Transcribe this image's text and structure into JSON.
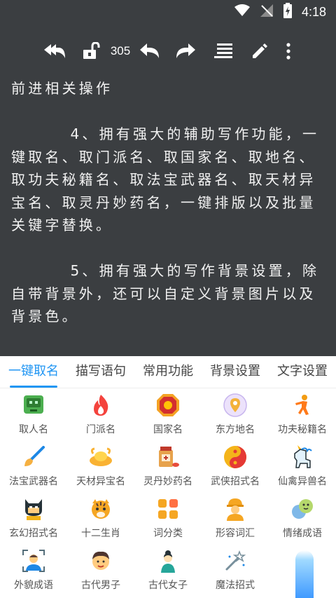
{
  "status_bar": {
    "time": "4:18"
  },
  "toolbar": {
    "counter": "305"
  },
  "editor": {
    "paragraphs": [
      "前进相关操作",
      "",
      "        4、拥有强大的辅助写作功能，一键取名、取门派名、取国家名、取地名、取功夫秘籍名、取法宝武器名、取天材异宝名、取灵丹妙药名，一键排版以及批量关键字替换。",
      "",
      "        5、拥有强大的写作背景设置，除自带背景外，还可以自定义背景图片以及背景色。"
    ]
  },
  "tabs": [
    {
      "label": "一键取名"
    },
    {
      "label": "描写语句"
    },
    {
      "label": "常用功能"
    },
    {
      "label": "背景设置"
    },
    {
      "label": "文字设置"
    }
  ],
  "grid": [
    {
      "label": "取人名",
      "icon": "robot-face-icon"
    },
    {
      "label": "门派名",
      "icon": "flame-icon"
    },
    {
      "label": "国家名",
      "icon": "emblem-icon"
    },
    {
      "label": "东方地名",
      "icon": "location-pin-icon"
    },
    {
      "label": "功夫秘籍名",
      "icon": "kungfu-icon"
    },
    {
      "label": "法宝武器名",
      "icon": "brush-icon"
    },
    {
      "label": "天材异宝名",
      "icon": "gold-ingot-icon"
    },
    {
      "label": "灵丹妙药名",
      "icon": "medicine-icon"
    },
    {
      "label": "武侠招式名",
      "icon": "yin-yang-icon"
    },
    {
      "label": "仙禽异兽名",
      "icon": "unicorn-icon"
    },
    {
      "label": "玄幻招式名",
      "icon": "masked-hero-icon"
    },
    {
      "label": "十二生肖",
      "icon": "tiger-icon"
    },
    {
      "label": "词分类",
      "icon": "categories-icon"
    },
    {
      "label": "形容词汇",
      "icon": "worker-icon"
    },
    {
      "label": "情绪成语",
      "icon": "emotions-icon"
    },
    {
      "label": "外貌成语",
      "icon": "face-scan-icon"
    },
    {
      "label": "古代男子",
      "icon": "man-face-icon"
    },
    {
      "label": "古代女子",
      "icon": "woman-icon"
    },
    {
      "label": "魔法招式",
      "icon": "magic-wand-icon"
    },
    {
      "label": "",
      "icon": "blank-icon"
    }
  ],
  "colors": {
    "accent": "#2196f3",
    "editor_bg": "#3b3e41"
  }
}
